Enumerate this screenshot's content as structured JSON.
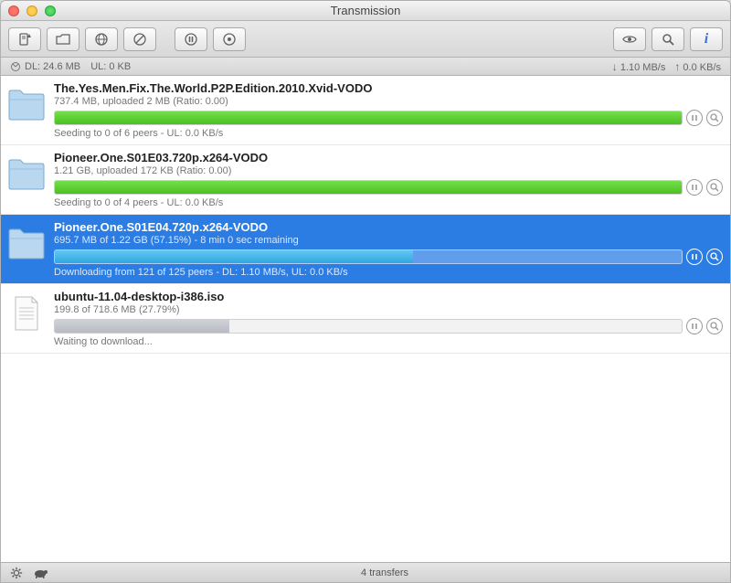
{
  "window": {
    "title": "Transmission"
  },
  "statusbar": {
    "ratio_dl": "DL: 24.6 MB",
    "ratio_ul": "UL: 0 KB",
    "down_rate": "1.10 MB/s",
    "up_rate": "0.0 KB/s"
  },
  "transfers": [
    {
      "icon": "folder",
      "name": "The.Yes.Men.Fix.The.World.P2P.Edition.2010.Xvid-VODO",
      "meta": "737.4 MB, uploaded 2 MB (Ratio: 0.00)",
      "progress": {
        "type": "seed",
        "percent": 100
      },
      "status": "Seeding to 0 of 6 peers - UL: 0.0 KB/s",
      "selected": false,
      "pausable": true
    },
    {
      "icon": "folder",
      "name": "Pioneer.One.S01E03.720p.x264-VODO",
      "meta": "1.21 GB, uploaded 172 KB (Ratio: 0.00)",
      "progress": {
        "type": "seed",
        "percent": 100
      },
      "status": "Seeding to 0 of 4 peers - UL: 0.0 KB/s",
      "selected": false,
      "pausable": true
    },
    {
      "icon": "folder",
      "name": "Pioneer.One.S01E04.720p.x264-VODO",
      "meta": "695.7 MB of 1.22 GB (57.15%) - 8 min 0 sec remaining",
      "progress": {
        "type": "download",
        "percent": 57.15
      },
      "status": "Downloading from 121 of 125 peers - DL: 1.10 MB/s, UL: 0.0 KB/s",
      "selected": true,
      "pausable": true
    },
    {
      "icon": "file",
      "name": "ubuntu-11.04-desktop-i386.iso",
      "meta": "199.8 of 718.6 MB (27.79%)",
      "progress": {
        "type": "wait",
        "percent": 27.79
      },
      "status": "Waiting to download...",
      "selected": false,
      "pausable": true
    }
  ],
  "bottombar": {
    "summary": "4 transfers"
  }
}
